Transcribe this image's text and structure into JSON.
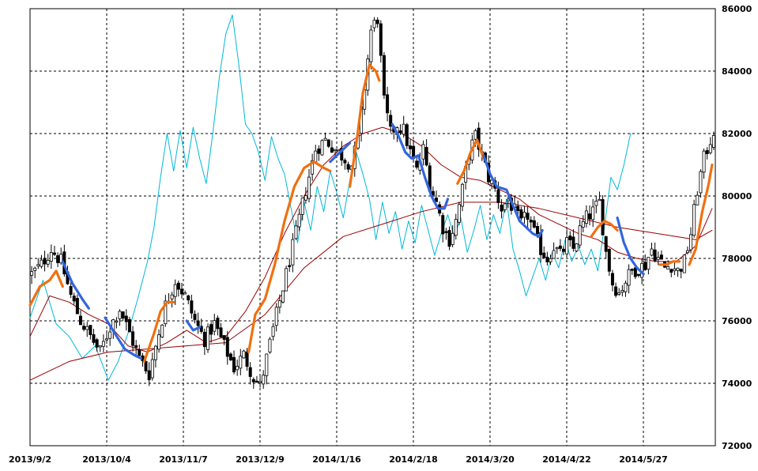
{
  "chart_data": {
    "type": "candlestick",
    "title": "",
    "xlabel": "",
    "ylabel": "",
    "ylim": [
      72000,
      86000
    ],
    "y_ticks": [
      72000,
      74000,
      76000,
      78000,
      80000,
      82000,
      84000,
      86000
    ],
    "x_tick_labels": [
      "2013/9/2",
      "2013/10/4",
      "2013/11/7",
      "2013/12/9",
      "2014/1/16",
      "2014/2/18",
      "2014/3/20",
      "2014/4/22",
      "2014/5/27"
    ],
    "grid": true,
    "candle_up_color": "#ffffff",
    "candle_down_color": "#000000",
    "price_path": [
      [
        0,
        77500
      ],
      [
        3,
        77800
      ],
      [
        6,
        78300
      ],
      [
        9,
        77900
      ],
      [
        12,
        76800
      ],
      [
        15,
        76000
      ],
      [
        18,
        75500
      ],
      [
        21,
        75000
      ],
      [
        24,
        75800
      ],
      [
        27,
        76400
      ],
      [
        30,
        75600
      ],
      [
        33,
        74800
      ],
      [
        36,
        74300
      ],
      [
        38,
        75200
      ],
      [
        41,
        76500
      ],
      [
        44,
        77300
      ],
      [
        47,
        76800
      ],
      [
        50,
        76000
      ],
      [
        53,
        75400
      ],
      [
        56,
        75900
      ],
      [
        59,
        75200
      ],
      [
        62,
        74500
      ],
      [
        65,
        74900
      ],
      [
        68,
        74200
      ],
      [
        70,
        73900
      ],
      [
        72,
        74800
      ],
      [
        75,
        76200
      ],
      [
        78,
        77500
      ],
      [
        81,
        78800
      ],
      [
        84,
        80200
      ],
      [
        87,
        81500
      ],
      [
        90,
        81800
      ],
      [
        93,
        81500
      ],
      [
        96,
        81200
      ],
      [
        98,
        81000
      ],
      [
        100,
        81800
      ],
      [
        102,
        83500
      ],
      [
        104,
        85300
      ],
      [
        106,
        85700
      ],
      [
        108,
        83000
      ],
      [
        110,
        82000
      ],
      [
        112,
        82300
      ],
      [
        114,
        82100
      ],
      [
        116,
        81400
      ],
      [
        118,
        80800
      ],
      [
        120,
        81500
      ],
      [
        122,
        80400
      ],
      [
        124,
        79800
      ],
      [
        126,
        79000
      ],
      [
        128,
        78600
      ],
      [
        130,
        79200
      ],
      [
        132,
        80200
      ],
      [
        134,
        81400
      ],
      [
        136,
        81900
      ],
      [
        138,
        81300
      ],
      [
        140,
        80600
      ],
      [
        142,
        80200
      ],
      [
        144,
        79600
      ],
      [
        146,
        79900
      ],
      [
        148,
        79500
      ],
      [
        150,
        79100
      ],
      [
        152,
        79400
      ],
      [
        154,
        78800
      ],
      [
        156,
        78300
      ],
      [
        158,
        78000
      ],
      [
        160,
        78400
      ],
      [
        162,
        78100
      ],
      [
        164,
        78500
      ],
      [
        166,
        78300
      ],
      [
        168,
        78900
      ],
      [
        170,
        79300
      ],
      [
        172,
        79500
      ],
      [
        174,
        79800
      ],
      [
        176,
        78200
      ],
      [
        178,
        77200
      ],
      [
        180,
        76900
      ],
      [
        182,
        77300
      ],
      [
        184,
        77600
      ],
      [
        186,
        77700
      ],
      [
        188,
        77800
      ],
      [
        190,
        78300
      ],
      [
        192,
        78000
      ],
      [
        194,
        77700
      ],
      [
        196,
        77800
      ],
      [
        198,
        77600
      ],
      [
        200,
        77900
      ],
      [
        202,
        78800
      ],
      [
        204,
        80200
      ],
      [
        206,
        81200
      ],
      [
        208,
        81800
      ],
      [
        209,
        82100
      ]
    ],
    "series": [
      {
        "color": "#00b8d8",
        "points": [
          [
            0,
            76100
          ],
          [
            4,
            77300
          ],
          [
            8,
            75900
          ],
          [
            12,
            75500
          ],
          [
            16,
            74800
          ],
          [
            20,
            75200
          ],
          [
            24,
            74100
          ],
          [
            27,
            74700
          ],
          [
            30,
            75600
          ],
          [
            33,
            76700
          ],
          [
            36,
            77900
          ],
          [
            38,
            79000
          ],
          [
            40,
            80600
          ],
          [
            42,
            82000
          ],
          [
            44,
            80800
          ],
          [
            46,
            82100
          ],
          [
            48,
            80900
          ],
          [
            50,
            82200
          ],
          [
            52,
            81200
          ],
          [
            54,
            80400
          ],
          [
            56,
            82000
          ],
          [
            58,
            83800
          ],
          [
            60,
            85200
          ],
          [
            62,
            85800
          ],
          [
            64,
            84200
          ],
          [
            66,
            82300
          ],
          [
            68,
            82000
          ],
          [
            70,
            81400
          ],
          [
            72,
            80500
          ],
          [
            74,
            81900
          ],
          [
            76,
            81200
          ],
          [
            78,
            80700
          ],
          [
            80,
            79600
          ],
          [
            82,
            78500
          ],
          [
            84,
            79800
          ],
          [
            86,
            78900
          ],
          [
            88,
            80300
          ],
          [
            90,
            79500
          ],
          [
            92,
            80800
          ],
          [
            94,
            80100
          ],
          [
            96,
            79300
          ],
          [
            98,
            80500
          ],
          [
            100,
            81400
          ],
          [
            102,
            80700
          ],
          [
            104,
            79900
          ],
          [
            106,
            78600
          ],
          [
            108,
            79800
          ],
          [
            110,
            78800
          ],
          [
            112,
            79500
          ],
          [
            114,
            78300
          ],
          [
            116,
            79200
          ],
          [
            118,
            78500
          ],
          [
            120,
            79700
          ],
          [
            122,
            78900
          ],
          [
            124,
            78100
          ],
          [
            126,
            78800
          ],
          [
            128,
            79400
          ],
          [
            130,
            78700
          ],
          [
            132,
            79300
          ],
          [
            134,
            78200
          ],
          [
            136,
            78900
          ],
          [
            138,
            79700
          ],
          [
            140,
            78600
          ],
          [
            142,
            79400
          ],
          [
            144,
            78800
          ],
          [
            146,
            79900
          ],
          [
            148,
            78300
          ],
          [
            150,
            77600
          ],
          [
            152,
            76800
          ],
          [
            154,
            77400
          ],
          [
            156,
            78000
          ],
          [
            158,
            77300
          ],
          [
            160,
            78200
          ],
          [
            162,
            77700
          ],
          [
            164,
            78600
          ],
          [
            166,
            77900
          ],
          [
            168,
            78400
          ],
          [
            170,
            77800
          ],
          [
            172,
            78300
          ],
          [
            174,
            77600
          ],
          [
            176,
            79000
          ],
          [
            178,
            80600
          ],
          [
            180,
            80200
          ],
          [
            182,
            81000
          ],
          [
            184,
            82000
          ]
        ]
      },
      {
        "color": "#990000",
        "points": [
          [
            0,
            75500
          ],
          [
            6,
            76800
          ],
          [
            12,
            76600
          ],
          [
            18,
            76200
          ],
          [
            24,
            75900
          ],
          [
            30,
            75200
          ],
          [
            36,
            75000
          ],
          [
            42,
            75300
          ],
          [
            48,
            75700
          ],
          [
            54,
            75300
          ],
          [
            60,
            75500
          ],
          [
            66,
            76300
          ],
          [
            72,
            77400
          ],
          [
            78,
            78800
          ],
          [
            84,
            80000
          ],
          [
            90,
            81000
          ],
          [
            96,
            81600
          ],
          [
            102,
            82000
          ],
          [
            108,
            82200
          ],
          [
            114,
            82000
          ],
          [
            120,
            81600
          ],
          [
            126,
            81000
          ],
          [
            132,
            80600
          ],
          [
            138,
            80500
          ],
          [
            144,
            80200
          ],
          [
            150,
            79900
          ],
          [
            156,
            79400
          ],
          [
            162,
            79100
          ],
          [
            168,
            78800
          ],
          [
            174,
            78600
          ],
          [
            180,
            78200
          ],
          [
            186,
            78000
          ],
          [
            192,
            77900
          ],
          [
            198,
            77900
          ],
          [
            204,
            78400
          ],
          [
            209,
            79600
          ]
        ]
      },
      {
        "color": "#990000",
        "points": [
          [
            0,
            74100
          ],
          [
            12,
            74700
          ],
          [
            24,
            75000
          ],
          [
            36,
            75100
          ],
          [
            48,
            75200
          ],
          [
            60,
            75300
          ],
          [
            72,
            76200
          ],
          [
            84,
            77700
          ],
          [
            96,
            78700
          ],
          [
            108,
            79100
          ],
          [
            120,
            79500
          ],
          [
            132,
            79800
          ],
          [
            144,
            79800
          ],
          [
            156,
            79600
          ],
          [
            168,
            79300
          ],
          [
            180,
            79000
          ],
          [
            192,
            78800
          ],
          [
            204,
            78600
          ],
          [
            209,
            78900
          ]
        ]
      },
      {
        "color": "#f07010",
        "points": [
          [
            0,
            76500
          ],
          [
            3,
            77100
          ],
          [
            6,
            77300
          ],
          [
            8,
            77600
          ],
          [
            10,
            77100
          ]
        ]
      },
      {
        "color": "#3366dd",
        "points": [
          [
            10,
            77900
          ],
          [
            13,
            77200
          ],
          [
            16,
            76700
          ],
          [
            18,
            76400
          ]
        ]
      },
      {
        "color": "#3366dd",
        "points": [
          [
            23,
            76100
          ],
          [
            26,
            75600
          ],
          [
            29,
            75100
          ],
          [
            32,
            74900
          ],
          [
            34,
            74800
          ]
        ]
      },
      {
        "color": "#f07010",
        "points": [
          [
            35,
            74700
          ],
          [
            38,
            75600
          ],
          [
            40,
            76300
          ],
          [
            42,
            76600
          ],
          [
            44,
            76600
          ]
        ]
      },
      {
        "color": "#3366dd",
        "points": [
          [
            48,
            76000
          ],
          [
            50,
            75700
          ],
          [
            52,
            75800
          ]
        ]
      },
      {
        "color": "#f07010",
        "points": [
          [
            67,
            75000
          ],
          [
            69,
            76200
          ],
          [
            72,
            76700
          ],
          [
            75,
            77800
          ],
          [
            78,
            79200
          ],
          [
            81,
            80300
          ],
          [
            84,
            80900
          ],
          [
            87,
            81100
          ],
          [
            90,
            80900
          ],
          [
            92,
            80800
          ]
        ]
      },
      {
        "color": "#3366dd",
        "points": [
          [
            92,
            81100
          ],
          [
            94,
            81300
          ],
          [
            96,
            81500
          ],
          [
            98,
            81700
          ]
        ]
      },
      {
        "color": "#f07010",
        "points": [
          [
            98,
            80300
          ],
          [
            100,
            81700
          ],
          [
            102,
            83300
          ],
          [
            104,
            84200
          ],
          [
            106,
            84000
          ],
          [
            107,
            83700
          ]
        ]
      },
      {
        "color": "#3366dd",
        "points": [
          [
            111,
            82300
          ],
          [
            113,
            81900
          ],
          [
            115,
            81400
          ],
          [
            117,
            81200
          ],
          [
            119,
            81300
          ],
          [
            121,
            80600
          ],
          [
            123,
            80000
          ],
          [
            125,
            79600
          ],
          [
            127,
            79600
          ],
          [
            128,
            79900
          ]
        ]
      },
      {
        "color": "#f07010",
        "points": [
          [
            131,
            80400
          ],
          [
            133,
            80800
          ],
          [
            135,
            81400
          ],
          [
            137,
            81800
          ],
          [
            139,
            81200
          ]
        ]
      },
      {
        "color": "#3366dd",
        "points": [
          [
            139,
            81300
          ],
          [
            141,
            80700
          ],
          [
            143,
            80300
          ],
          [
            146,
            80200
          ],
          [
            148,
            79700
          ],
          [
            150,
            79200
          ],
          [
            152,
            79000
          ],
          [
            154,
            78800
          ],
          [
            156,
            78700
          ],
          [
            157,
            78900
          ]
        ]
      },
      {
        "color": "#f07010",
        "points": [
          [
            172,
            78700
          ],
          [
            174,
            79000
          ],
          [
            176,
            79200
          ],
          [
            178,
            79100
          ],
          [
            180,
            78900
          ]
        ]
      },
      {
        "color": "#3366dd",
        "points": [
          [
            180,
            79300
          ],
          [
            182,
            78500
          ],
          [
            184,
            78000
          ],
          [
            186,
            77700
          ],
          [
            188,
            77500
          ]
        ]
      },
      {
        "color": "#f07010",
        "points": [
          [
            193,
            77800
          ],
          [
            195,
            77800
          ],
          [
            197,
            77900
          ],
          [
            199,
            77900
          ]
        ]
      },
      {
        "color": "#f07010",
        "points": [
          [
            202,
            77800
          ],
          [
            204,
            78300
          ],
          [
            206,
            79500
          ],
          [
            208,
            80400
          ],
          [
            209,
            81000
          ]
        ]
      }
    ]
  }
}
